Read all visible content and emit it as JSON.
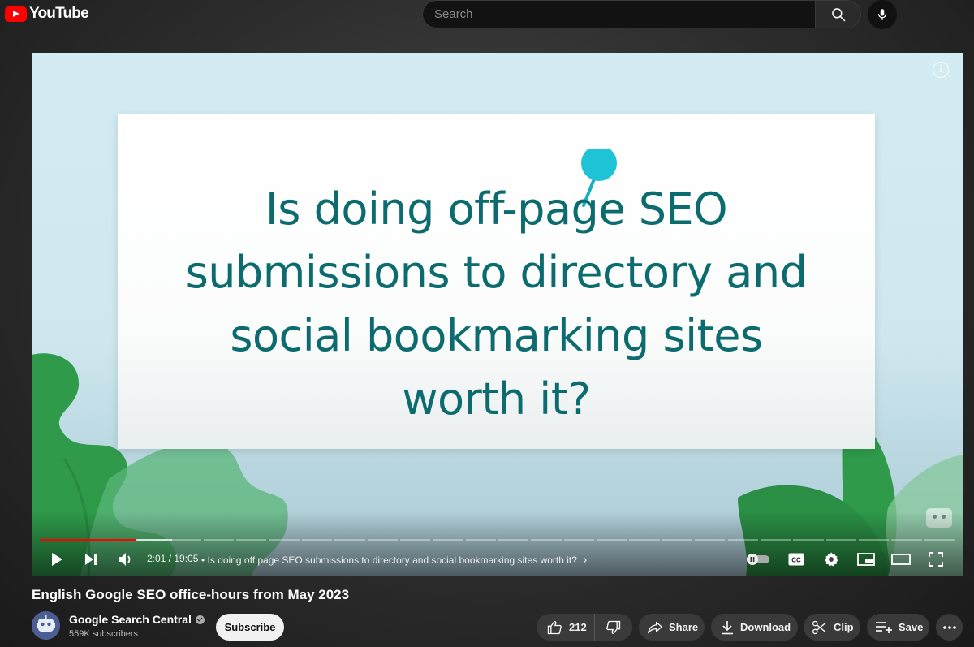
{
  "header": {
    "logo_text": "YouTube",
    "search_placeholder": "Search"
  },
  "player": {
    "slide_lines": [
      "Is doing off-page SEO",
      "submissions to directory and",
      "social bookmarking sites",
      "worth it?"
    ],
    "info_glyph": "i",
    "time": "2:01 / 19:05",
    "chapter": "• Is doing off page SEO submissions to directory and social bookmarking sites worth it?",
    "chapter_chevron": "›",
    "played_fraction": 0.106,
    "buffered_fraction": 0.145,
    "accent_color": "#ff0000",
    "controls": [
      "play-icon",
      "next-icon",
      "volume-icon",
      "autoplay-toggle",
      "cc-icon",
      "settings-icon",
      "miniplayer-icon",
      "theater-icon",
      "fullscreen-icon"
    ]
  },
  "video": {
    "title": "English Google SEO office-hours from May 2023"
  },
  "channel": {
    "name": "Google Search Central",
    "subscribers": "559K subscribers",
    "subscribe_label": "Subscribe"
  },
  "actions": {
    "likes": "212",
    "share_label": "Share",
    "download_label": "Download",
    "clip_label": "Clip",
    "save_label": "Save"
  }
}
